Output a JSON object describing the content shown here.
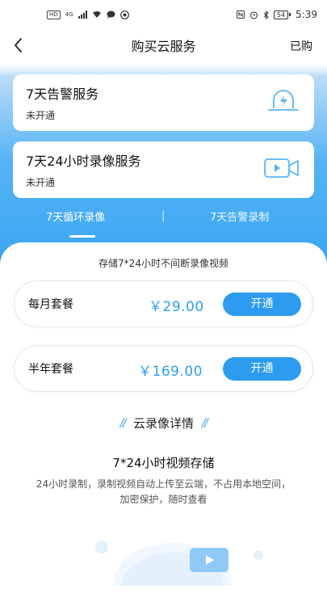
{
  "status_bar": {
    "left_badges": [
      "HD",
      "4G"
    ],
    "time": "5:39",
    "battery": "54"
  },
  "nav": {
    "title": "购买云服务",
    "right_label": "已购"
  },
  "services": [
    {
      "title": "7天告警服务",
      "status": "未开通",
      "icon": "alarm-light-icon"
    },
    {
      "title": "7天24小时录像服务",
      "status": "未开通",
      "icon": "video-camera-icon"
    }
  ],
  "tabs": [
    {
      "label": "7天循环录像",
      "active": true
    },
    {
      "label": "7天告警录制",
      "active": false
    }
  ],
  "tab_separator": "|",
  "panel": {
    "subtitle": "存储7*24小时不间断录像视频",
    "plans": [
      {
        "name": "每月套餐",
        "price": "￥29.00",
        "button": "开通"
      },
      {
        "name": "半年套餐",
        "price": "￥169.00",
        "button": "开通"
      }
    ],
    "section_title": "云录像详情",
    "section_deco": "//",
    "detail_title": "7*24小时视频存储",
    "detail_desc": "24小时录制，录制视频自动上传至云端，不占用本地空间，加密保护，随时查看"
  },
  "colors": {
    "accent": "#2d9cf0",
    "price": "#2f9ef0",
    "header_gradient": "#3aa6f3"
  }
}
